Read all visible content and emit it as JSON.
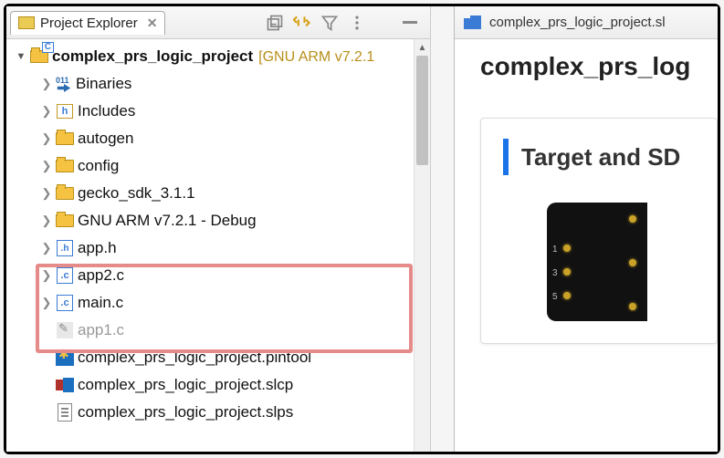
{
  "tabs": {
    "project_explorer": "Project Explorer"
  },
  "tree": {
    "root": {
      "label": "complex_prs_logic_project",
      "decoration": "[GNU ARM v7.2.1"
    },
    "items": [
      {
        "label": "Binaries"
      },
      {
        "label": "Includes"
      },
      {
        "label": "autogen"
      },
      {
        "label": "config"
      },
      {
        "label": "gecko_sdk_3.1.1"
      },
      {
        "label": "GNU ARM v7.2.1 - Debug"
      },
      {
        "label": "app.h"
      },
      {
        "label": "app2.c"
      },
      {
        "label": "main.c"
      },
      {
        "label": "app1.c"
      },
      {
        "label": "complex_prs_logic_project.pintool"
      },
      {
        "label": "complex_prs_logic_project.slcp"
      },
      {
        "label": "complex_prs_logic_project.slps"
      }
    ]
  },
  "editor": {
    "tab_label": "complex_prs_logic_project.sl",
    "title": "complex_prs_log",
    "card_title": "Target and SD",
    "board_pins": [
      "1",
      "3",
      "5"
    ]
  }
}
